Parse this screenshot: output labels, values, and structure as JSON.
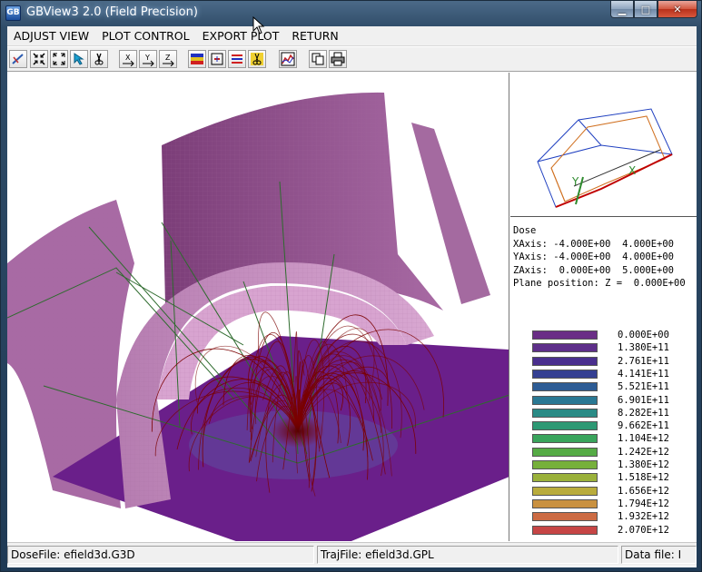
{
  "window": {
    "title": "GBView3 2.0 (Field Precision)",
    "app_icon_text": "GB"
  },
  "menu": [
    "ADJUST VIEW",
    "PLOT CONTROL",
    "EXPORT PLOT",
    "RETURN"
  ],
  "toolbar": {
    "buttons": [
      "view-icon",
      "shrink-icon",
      "expand-icon",
      "pointer-icon",
      "cut-icon",
      "x-axis-icon",
      "y-axis-icon",
      "z-axis-icon",
      "color-map-icon",
      "contour-icon",
      "lines-icon",
      "slice-icon",
      "plot-icon",
      "copy-icon",
      "print-icon"
    ]
  },
  "info_panel": {
    "quantity": "Dose",
    "xaxis": "XAxis: -4.000E+00  4.000E+00",
    "yaxis": "YAxis: -4.000E+00  4.000E+00",
    "zaxis": "ZAxis:  0.000E+00  5.000E+00",
    "plane": "Plane position: Z =  0.000E+00"
  },
  "orientation_axes": {
    "x": "X",
    "y": "Y"
  },
  "legend": [
    {
      "value": "0.000E+00",
      "color": "#6a2e86"
    },
    {
      "value": "1.380E+11",
      "color": "#5e2f8a"
    },
    {
      "value": "2.761E+11",
      "color": "#4a2f8e"
    },
    {
      "value": "4.141E+11",
      "color": "#343f92"
    },
    {
      "value": "5.521E+11",
      "color": "#2d5c95"
    },
    {
      "value": "6.901E+11",
      "color": "#2a7893"
    },
    {
      "value": "8.282E+11",
      "color": "#2a8b86"
    },
    {
      "value": "9.662E+11",
      "color": "#2d9974"
    },
    {
      "value": "1.104E+12",
      "color": "#39a45c"
    },
    {
      "value": "1.242E+12",
      "color": "#55ab45"
    },
    {
      "value": "1.380E+12",
      "color": "#76b03a"
    },
    {
      "value": "1.518E+12",
      "color": "#9ab13a"
    },
    {
      "value": "1.656E+12",
      "color": "#b9ac3c"
    },
    {
      "value": "1.794E+12",
      "color": "#c99140"
    },
    {
      "value": "1.932E+12",
      "color": "#cc6b43"
    },
    {
      "value": "2.070E+12",
      "color": "#c64545"
    }
  ],
  "status": {
    "dose_file": "DoseFile: efield3d.G3D",
    "traj_file": "TrajFile: efield3d.GPL",
    "data_file": "Data file: I"
  },
  "colors": {
    "plane": "#6a1f8a",
    "shell": "#c78fc2",
    "trajectory": "#7a0000",
    "axis_line": "#2e6b2e"
  }
}
